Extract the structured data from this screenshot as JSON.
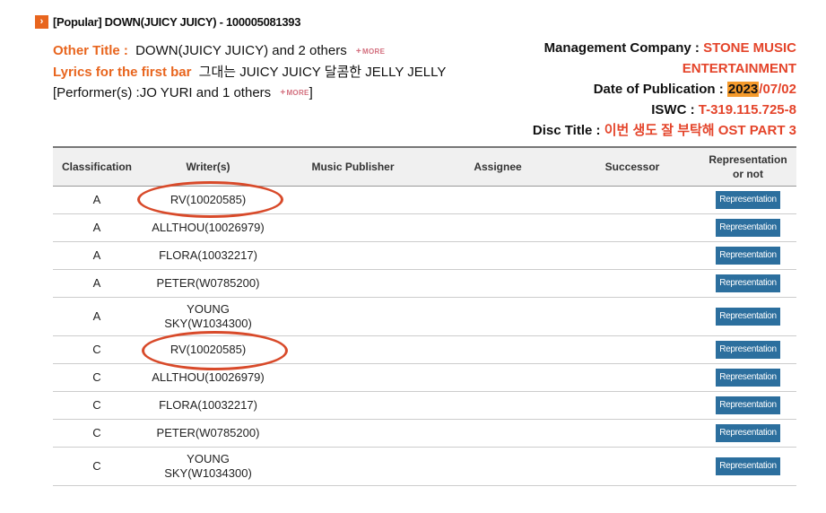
{
  "page": {
    "title": "[Popular] DOWN(JUICY JUICY) - 100005081393",
    "title_icon": "chevron-right-icon"
  },
  "info_left": {
    "other_title_label": "Other Title :",
    "other_title_value": "DOWN(JUICY JUICY) and 2 others",
    "lyrics_label": "Lyrics for the first bar",
    "lyrics_value": "그대는 JUICY JUICY 달콤한 JELLY JELLY",
    "performer_prefix": "[Performer(s) :",
    "performer_value": "JO YURI and 1 others",
    "performer_suffix": "]",
    "more_label": "MORE"
  },
  "info_right": {
    "mgmt_label": "Management Company :",
    "mgmt_value_line1": "STONE MUSIC",
    "mgmt_value_line2": "ENTERTAINMENT",
    "pub_label": "Date of Publication :",
    "pub_year": "2023",
    "pub_rest": "/07/02",
    "iswc_label": "ISWC :",
    "iswc_value": "T-319.115.725-8",
    "disc_label": "Disc Title :",
    "disc_value": "이번 생도 잘 부탁해 OST PART 3"
  },
  "table": {
    "headers": {
      "classification": "Classification",
      "writers": "Writer(s)",
      "publisher": "Music Publisher",
      "assignee": "Assignee",
      "successor": "Successor",
      "representation_l1": "Representation",
      "representation_l2": "or not"
    },
    "button_label": "Representation",
    "rows": [
      {
        "cls": "A",
        "w1": "RV(10020585)",
        "w2": ""
      },
      {
        "cls": "A",
        "w1": "ALLTHOU(10026979)",
        "w2": ""
      },
      {
        "cls": "A",
        "w1": "FLORA(10032217)",
        "w2": ""
      },
      {
        "cls": "A",
        "w1": "PETER(W0785200)",
        "w2": ""
      },
      {
        "cls": "A",
        "w1": "YOUNG",
        "w2": "SKY(W1034300)"
      },
      {
        "cls": "C",
        "w1": "RV(10020585)",
        "w2": ""
      },
      {
        "cls": "C",
        "w1": "ALLTHOU(10026979)",
        "w2": ""
      },
      {
        "cls": "C",
        "w1": "FLORA(10032217)",
        "w2": ""
      },
      {
        "cls": "C",
        "w1": "PETER(W0785200)",
        "w2": ""
      },
      {
        "cls": "C",
        "w1": "YOUNG",
        "w2": "SKY(W1034300)"
      }
    ]
  },
  "colors": {
    "accent_orange": "#e8651e",
    "value_red": "#e4442a",
    "highlight": "#f59a2b",
    "button_blue": "#2c6f9e",
    "annotation_red": "#d84a2a"
  }
}
